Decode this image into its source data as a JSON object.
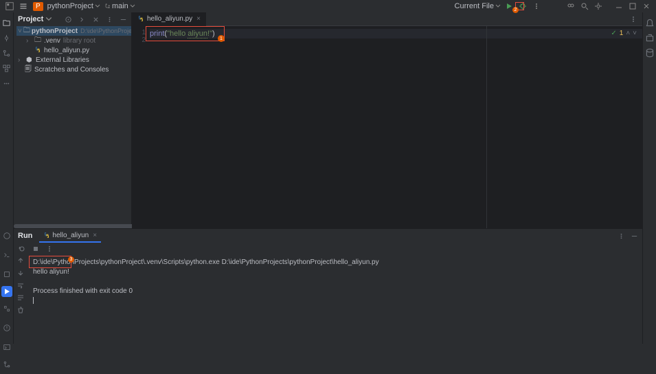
{
  "topbar": {
    "project_badge": "P",
    "project_name": "pythonProject",
    "branch_icon": "⎇",
    "branch_name": "main",
    "run_config": "Current File"
  },
  "project_tool": {
    "title": "Project",
    "root": "pythonProject",
    "root_path": "D:\\ide\\PythonProjects\\pythonProject",
    "venv": ".venv",
    "venv_hint": "library root",
    "file": "hello_aliyun.py",
    "ext_lib": "External Libraries",
    "scratch": "Scratches and Consoles"
  },
  "editor": {
    "tab_file": "hello_aliyun.py",
    "line1_no": "1",
    "line2_no": "2",
    "code": {
      "fn": "print",
      "open": "(",
      "str_open": "\"",
      "str1": "hello ",
      "str_typo": "aliyun",
      "str2": "!\"",
      "close": ")"
    },
    "inspect_count": "1"
  },
  "run_tool": {
    "title": "Run",
    "tab": "hello_aliyun",
    "console": {
      "cmd": "D:\\ide\\PythonProjects\\pythonProject\\.venv\\Scripts\\python.exe D:\\ide\\PythonProjects\\pythonProject\\hello_aliyun.py",
      "out": "hello aliyun!",
      "exit": "Process finished with exit code 0"
    }
  },
  "badges": {
    "b1": "1",
    "b2": "2",
    "b3": "3"
  }
}
